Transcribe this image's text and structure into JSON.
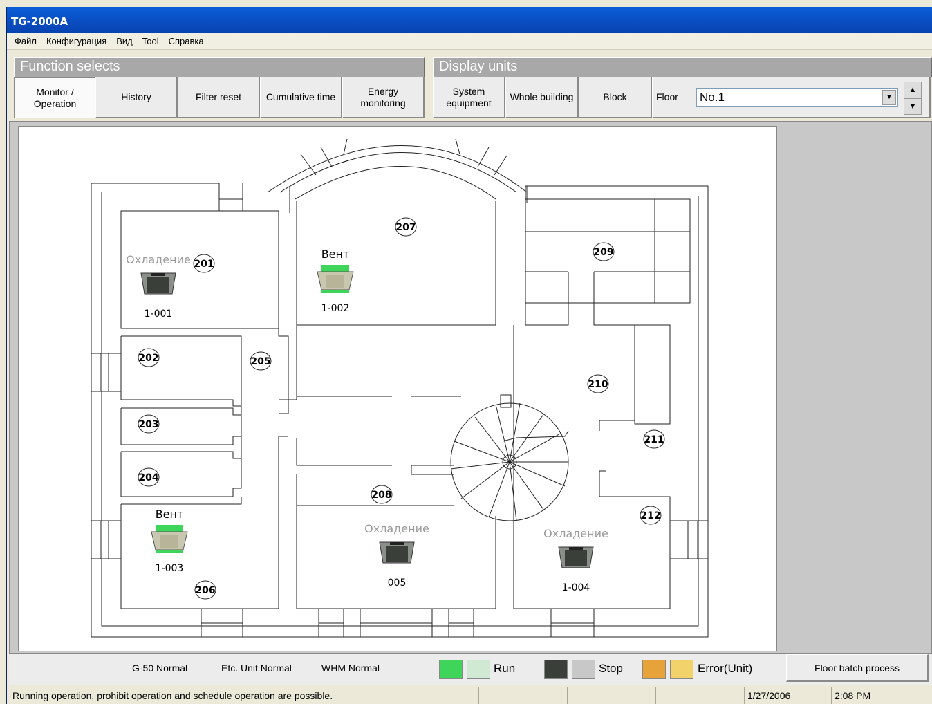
{
  "window": {
    "title": "TG-2000A"
  },
  "menu": [
    "Файл",
    "Конфигурация",
    "Вид",
    "Tool",
    "Справка"
  ],
  "function_selects": {
    "header": "Function selects",
    "buttons": [
      "Monitor /\nOperation",
      "History",
      "Filter reset",
      "Cumulative time",
      "Energy\nmonitoring"
    ]
  },
  "display_units": {
    "header": "Display units",
    "buttons": [
      "System\nequipment",
      "Whole building",
      "Block"
    ],
    "floor_label": "Floor",
    "floor_value": "No.1"
  },
  "rooms": [
    "201",
    "202",
    "203",
    "204",
    "205",
    "206",
    "207",
    "208",
    "209",
    "210",
    "211",
    "212"
  ],
  "units": [
    {
      "id": "1-001",
      "status": "Охладение",
      "state": "stop"
    },
    {
      "id": "1-002",
      "status": "Вент",
      "state": "run"
    },
    {
      "id": "1-003",
      "status": "Вент",
      "state": "run"
    },
    {
      "id": "005",
      "status": "Охладение",
      "state": "stop"
    },
    {
      "id": "1-004",
      "status": "Охладение",
      "state": "stop"
    }
  ],
  "legend": {
    "g50": "G-50  Normal",
    "etc": "Etc. Unit Normal",
    "whm": "WHM  Normal",
    "run": "Run",
    "stop": "Stop",
    "error": "Error(Unit)",
    "batch": "Floor batch process"
  },
  "statusbar": {
    "message": "Running operation, prohibit operation and schedule operation are possible.",
    "date": "1/27/2006",
    "time": "2:08 PM"
  },
  "colors": {
    "title_bar": "#0a4fc4",
    "run_green": "#3fd45a",
    "unit_dark": "#3a3f3a"
  }
}
